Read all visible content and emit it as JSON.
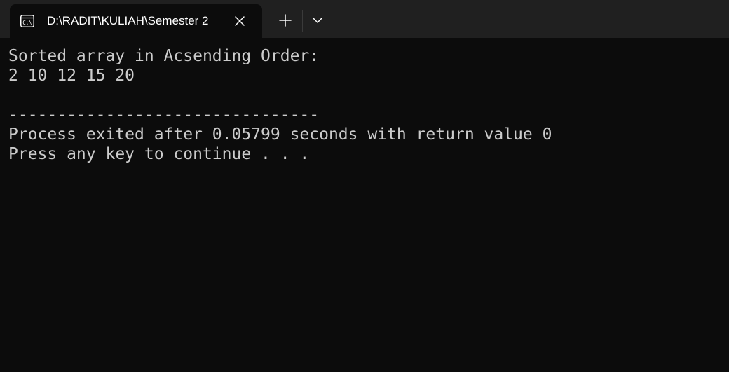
{
  "tab": {
    "title": "D:\\RADIT\\KULIAH\\Semester 2",
    "icon": "terminal-icon",
    "icon_text": "C:\\"
  },
  "toolbar": {
    "new_tab_icon": "plus-icon",
    "dropdown_icon": "chevron-down-icon"
  },
  "console": {
    "lines": [
      "Sorted array in Acsending Order:",
      "2 10 12 15 20",
      "",
      "--------------------------------",
      "Process exited after 0.05799 seconds with return value 0",
      "Press any key to continue . . ."
    ]
  },
  "colors": {
    "background": "#0c0c0c",
    "tabbar": "#202020",
    "text": "#cccccc"
  }
}
